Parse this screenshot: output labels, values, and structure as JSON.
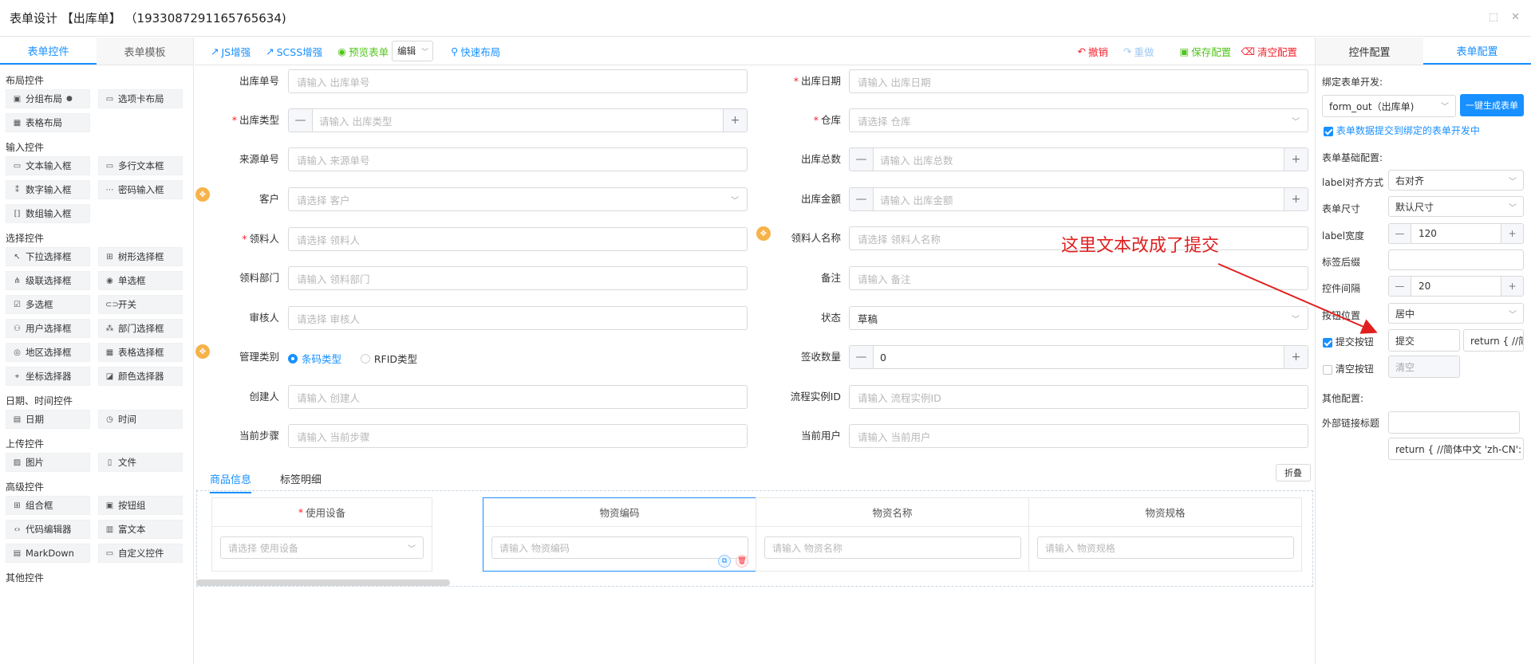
{
  "title": "表单设计 【出库单】 （1933087291165765634)",
  "window_controls": {
    "restore": "⬚",
    "close": "✕"
  },
  "left_panel": {
    "tabs": [
      "表单控件",
      "表单模板"
    ],
    "sections": [
      {
        "title": "布局控件",
        "items": [
          "分组布局",
          "选项卡布局",
          "表格布局"
        ]
      },
      {
        "title": "输入控件",
        "items": [
          "文本输入框",
          "多行文本框",
          "数字输入框",
          "密码输入框",
          "数组输入框"
        ]
      },
      {
        "title": "选择控件",
        "items": [
          "下拉选择框",
          "树形选择框",
          "级联选择框",
          "单选框",
          "多选框",
          "开关",
          "用户选择框",
          "部门选择框",
          "地区选择框",
          "表格选择框",
          "坐标选择器",
          "颜色选择器"
        ]
      },
      {
        "title": "日期、时间控件",
        "items": [
          "日期",
          "时间"
        ]
      },
      {
        "title": "上传控件",
        "items": [
          "图片",
          "文件"
        ]
      },
      {
        "title": "高级控件",
        "items": [
          "组合框",
          "按钮组",
          "代码编辑器",
          "富文本",
          "MarkDown",
          "自定义控件"
        ]
      },
      {
        "title": "其他控件",
        "items": []
      }
    ]
  },
  "toolbar": {
    "js": "JS增强",
    "scss": "SCSS增强",
    "preview": "预览表单",
    "mode": "编辑",
    "quick_layout": "快速布局",
    "undo": "撤销",
    "redo": "重做",
    "save": "保存配置",
    "clear": "清空配置"
  },
  "form": {
    "fields": {
      "out_no": {
        "label": "出库单号",
        "placeholder": "请输入 出库单号"
      },
      "out_date": {
        "label": "出库日期",
        "placeholder": "请输入 出库日期"
      },
      "out_type": {
        "label": "出库类型",
        "placeholder": "请输入 出库类型"
      },
      "warehouse": {
        "label": "仓库",
        "placeholder": "请选择 仓库"
      },
      "source_no": {
        "label": "来源单号",
        "placeholder": "请输入 来源单号"
      },
      "total": {
        "label": "出库总数",
        "placeholder": "请输入 出库总数"
      },
      "customer": {
        "label": "客户",
        "placeholder": "请选择 客户"
      },
      "amount": {
        "label": "出库金额",
        "placeholder": "请输入 出库金额"
      },
      "receiver": {
        "label": "领料人",
        "placeholder": "请选择 领料人"
      },
      "receiver_name": {
        "label": "领料人名称",
        "placeholder": "请选择 领料人名称"
      },
      "dept": {
        "label": "领料部门",
        "placeholder": "请输入 领料部门"
      },
      "remark": {
        "label": "备注",
        "placeholder": "请输入 备注"
      },
      "auditor": {
        "label": "审核人",
        "placeholder": "请选择 审核人"
      },
      "status": {
        "label": "状态",
        "value": "草稿"
      },
      "mgmt_type": {
        "label": "管理类别",
        "options": [
          "条码类型",
          "RFID类型"
        ]
      },
      "sign_qty": {
        "label": "签收数量",
        "value": "0"
      },
      "creator": {
        "label": "创建人",
        "placeholder": "请输入 创建人"
      },
      "process_id": {
        "label": "流程实例ID",
        "placeholder": "请输入 流程实例ID"
      },
      "current_step": {
        "label": "当前步骤",
        "placeholder": "请输入 当前步骤"
      },
      "current_user": {
        "label": "当前用户",
        "placeholder": "请输入 当前用户"
      }
    },
    "subtabs": [
      "商品信息",
      "标签明细"
    ],
    "fold": "折叠",
    "table": {
      "columns": [
        {
          "header": "使用设备",
          "required": true,
          "placeholder": "请选择 使用设备"
        },
        {
          "header": "物资编码",
          "placeholder": "请输入 物资编码"
        },
        {
          "header": "物资名称",
          "placeholder": "请输入 物资名称"
        },
        {
          "header": "物资规格",
          "placeholder": "请输入 物资规格"
        }
      ]
    }
  },
  "right_panel": {
    "tabs": [
      "控件配置",
      "表单配置"
    ],
    "bind_label": "绑定表单开发:",
    "bind_value": "form_out（出库单)",
    "gen_button": "一键生成表单",
    "submit_to_bound": "表单数据提交到绑定的表单开发中",
    "basic_title": "表单基础配置:",
    "label_align": {
      "label": "label对齐方式",
      "value": "右对齐"
    },
    "form_size": {
      "label": "表单尺寸",
      "value": "默认尺寸"
    },
    "label_width": {
      "label": "label宽度",
      "value": "120"
    },
    "label_suffix": {
      "label": "标签后缀",
      "value": ""
    },
    "ctl_gap": {
      "label": "控件间隔",
      "value": "20"
    },
    "btn_pos": {
      "label": "按钮位置",
      "value": "居中"
    },
    "submit_btn": {
      "label": "提交按钮",
      "value": "提交",
      "code": "return {  //简"
    },
    "clear_btn": {
      "label": "清空按钮",
      "value": "清空"
    },
    "other_title": "其他配置:",
    "ext_link": {
      "label": "外部链接标题",
      "value": ""
    },
    "ext_code": "return {  //简体中文 'zh-CN': '"
  },
  "annotation": "这里文本改成了提交",
  "colors": {
    "primary": "#1890ff",
    "danger": "#f5222d",
    "success": "#52c41a",
    "annot": "#e02020"
  }
}
